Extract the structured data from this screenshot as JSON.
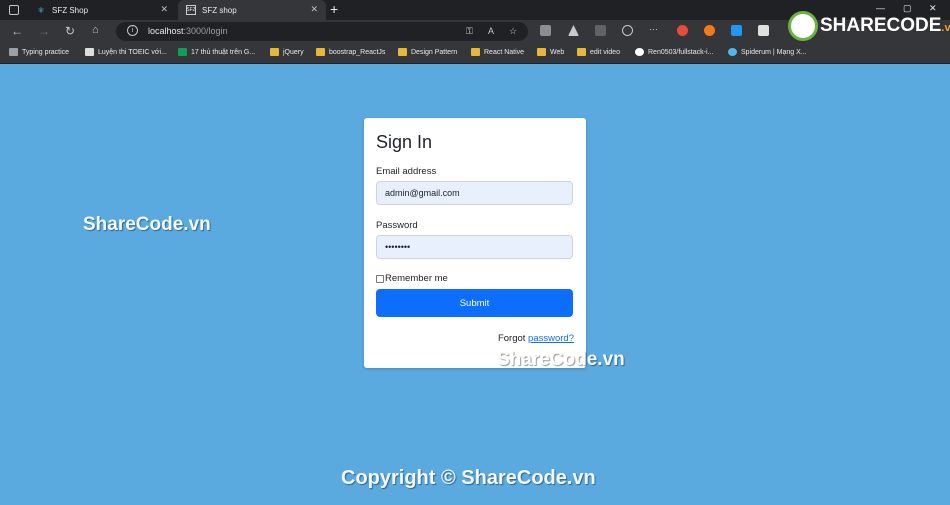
{
  "browser": {
    "tabs": [
      {
        "title": "SFZ Shop",
        "active": false
      },
      {
        "title": "SFZ shop",
        "active": true
      }
    ],
    "url_host": "localhost",
    "url_path": ":3000/login"
  },
  "bookmarks": [
    {
      "label": "Typing practice",
      "icon": "typing-icon"
    },
    {
      "label": "Luyện thi TOEIC với...",
      "icon": "toeic-icon"
    },
    {
      "label": "17 thủ thuật trên G...",
      "icon": "sheet-icon"
    },
    {
      "label": "jQuery",
      "icon": "folder-icon"
    },
    {
      "label": "boostrap_ReactJs",
      "icon": "folder-icon"
    },
    {
      "label": "Design Pattern",
      "icon": "folder-icon"
    },
    {
      "label": "React Native",
      "icon": "folder-icon"
    },
    {
      "label": "Web",
      "icon": "folder-icon"
    },
    {
      "label": "edit video",
      "icon": "folder-icon"
    },
    {
      "label": "Ren0503/fullstack-i...",
      "icon": "github-icon"
    },
    {
      "label": "Spiderum | Mạng X...",
      "icon": "spiderum-icon"
    }
  ],
  "login": {
    "title": "Sign In",
    "email_label": "Email address",
    "email_value": "admin@gmail.com",
    "password_label": "Password",
    "password_value": "••••••••",
    "remember_label": "Remember me",
    "submit_label": "Submit",
    "forgot_prefix": "Forgot ",
    "forgot_link": "password?"
  },
  "watermarks": {
    "left": "ShareCode.vn",
    "center": "ShareCode.vn",
    "footer": "Copyright © ShareCode.vn",
    "logo_main": "SHARECODE",
    "logo_suffix": ".vn"
  },
  "colors": {
    "page_bg": "#5aaae0",
    "primary": "#0d6efd",
    "input_bg": "#e8f0fe"
  }
}
